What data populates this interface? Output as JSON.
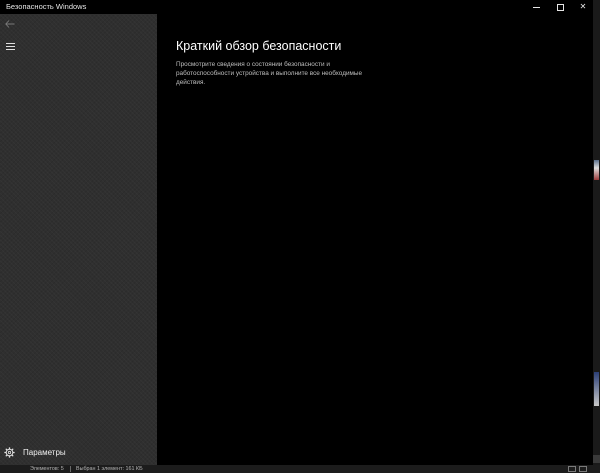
{
  "window": {
    "title": "Безопасность Windows",
    "controls": {
      "minimize": "minimize-icon",
      "maximize": "maximize-icon",
      "close": "close-icon",
      "close_glyph": "✕"
    }
  },
  "sidebar": {
    "back_icon": "back-arrow-icon",
    "menu_icon": "hamburger-menu-icon",
    "settings": {
      "icon": "gear-icon",
      "label": "Параметры"
    },
    "background_color": "#2f2f2f"
  },
  "main": {
    "title": "Краткий обзор безопасности",
    "description": "Просмотрите сведения о состоянии безопасности и работоспособности устройства и выполните все необходимые действия.",
    "background_color": "#000000"
  },
  "background": {
    "explorer_status": {
      "items_count": "Элементов: 5",
      "selected": "Выбран 1 элемент: 161 КБ"
    }
  }
}
